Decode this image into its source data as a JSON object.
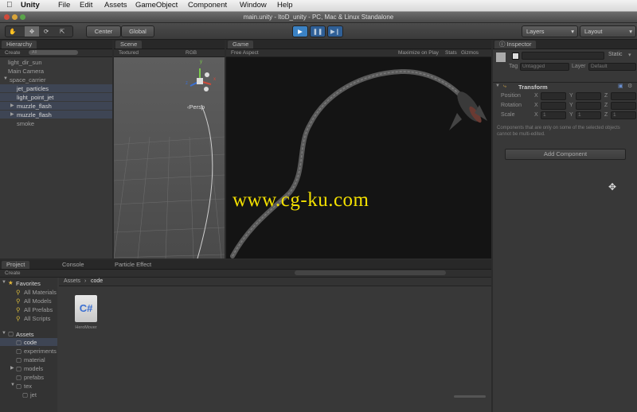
{
  "menubar": {
    "apple": "",
    "app": "Unity",
    "items": [
      "File",
      "Edit",
      "Assets",
      "GameObject",
      "Component",
      "Window",
      "Help"
    ]
  },
  "window": {
    "title": "main.unity - ltoD_unity - PC, Mac & Linux Standalone"
  },
  "toolbar": {
    "pivot": "Center",
    "space": "Global",
    "layers": "Layers",
    "layout": "Layout"
  },
  "hierarchy": {
    "tab": "Hierarchy",
    "create": "Create",
    "search_placeholder": "All",
    "items": [
      "light_dir_sun",
      "Main Camera",
      "space_carrier",
      "jet_particles",
      "light_point_jet",
      "muzzle_flash",
      "muzzle_flash",
      "smoke"
    ]
  },
  "scene": {
    "tab": "Scene",
    "shading": "Textured",
    "render": "RGB",
    "persp": "Persp",
    "gizmo_axes": [
      "y",
      "x",
      "z"
    ]
  },
  "game": {
    "tab": "Game",
    "aspect": "Free Aspect",
    "maximize": "Maximize on Play",
    "stats": "Stats",
    "gizmos": "Gizmos"
  },
  "inspector": {
    "tab": "Inspector",
    "static": "Static",
    "tag_label": "Tag",
    "tag_value": "Untagged",
    "layer_label": "Layer",
    "layer_value": "Default",
    "component": "Transform",
    "position": "Position",
    "rotation": "Rotation",
    "scale": "Scale",
    "axes": [
      "X",
      "Y",
      "Z"
    ],
    "scale_values": [
      "1",
      "1",
      "1"
    ],
    "note": "Components that are only on some of the selected objects cannot be multi-edited.",
    "add_component": "Add Component"
  },
  "bottom_tabs": {
    "project": "Project",
    "console": "Console",
    "particle": "Particle Effect"
  },
  "project": {
    "create": "Create",
    "favorites_label": "Favorites",
    "favorites": [
      "All Materials",
      "All Models",
      "All Prefabs",
      "All Scripts"
    ],
    "assets_label": "Assets",
    "folders": [
      "code",
      "experiments",
      "material",
      "models",
      "prefabs",
      "tex",
      "jet"
    ],
    "breadcrumb": [
      "Assets",
      "code"
    ],
    "file_name": "HeroMover",
    "file_icon": "C#"
  },
  "watermark": "www.cg-ku.com",
  "colors": {
    "accent_play": "#3b82c4",
    "selection": "#3e4554",
    "bg": "#383838"
  }
}
